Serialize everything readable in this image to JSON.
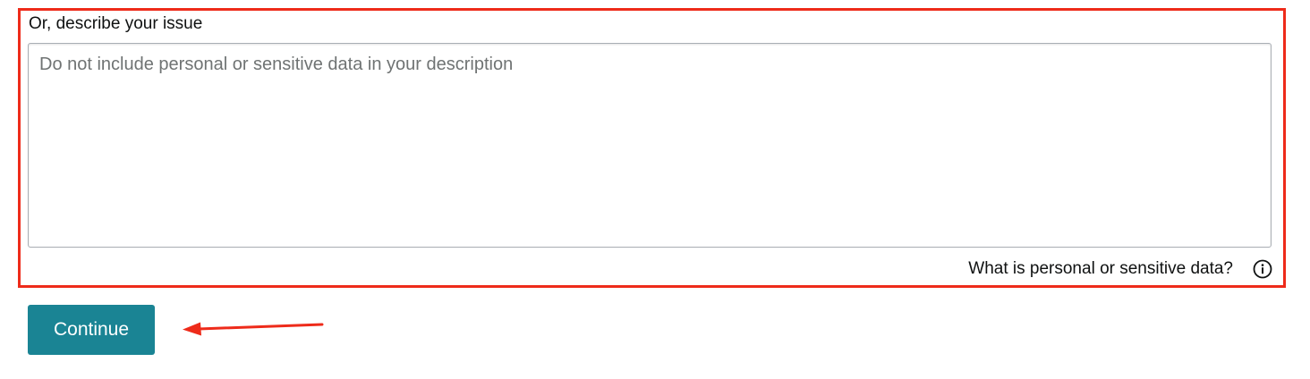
{
  "issue_field": {
    "label": "Or, describe your issue",
    "value": "",
    "placeholder": "Do not include personal or sensitive data in your description"
  },
  "help": {
    "link_label": "What is personal or sensitive data?",
    "icon": "info-icon"
  },
  "continue_label": "Continue",
  "annotation": {
    "highlight_color": "#ee2b1a",
    "arrow_color": "#ee2b1a",
    "arrow_icon": "arrow-left-icon"
  },
  "colors": {
    "button_bg": "#1a8494",
    "text": "#0f1111"
  }
}
